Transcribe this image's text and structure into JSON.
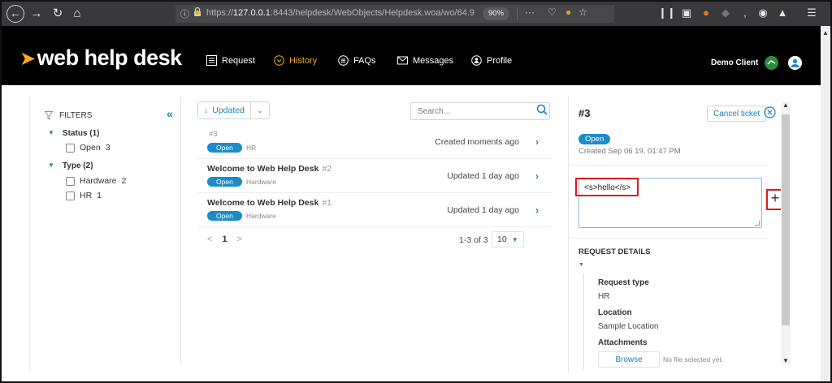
{
  "browser": {
    "url_host": "127.0.0.1",
    "url_prefix": "https://",
    "url_rest": ":8443/helpdesk/WebObjects/Helpdesk.woa/wo/64.9",
    "zoom": "90%",
    "more": "···"
  },
  "header": {
    "logo": "web help desk",
    "nav": [
      {
        "label": "Request"
      },
      {
        "label": "History"
      },
      {
        "label": "FAQs"
      },
      {
        "label": "Messages"
      },
      {
        "label": "Profile"
      }
    ],
    "user_name": "Demo Client"
  },
  "filters": {
    "title": "FILTERS",
    "groups": [
      {
        "label": "Status (1)",
        "items": [
          {
            "label": "Open",
            "count": "3"
          }
        ]
      },
      {
        "label": "Type (2)",
        "items": [
          {
            "label": "Hardware",
            "count": "2"
          },
          {
            "label": "HR",
            "count": "1"
          }
        ]
      }
    ]
  },
  "list": {
    "sort_label": "Updated",
    "search_placeholder": "Search...",
    "rows": [
      {
        "title": "",
        "num": "#3",
        "badge": "Open",
        "category": "HR",
        "status": "Created moments ago"
      },
      {
        "title": "Welcome to Web Help Desk",
        "num": "#2",
        "badge": "Open",
        "category": "Hardware",
        "status": "Updated 1 day ago"
      },
      {
        "title": "Welcome to Web Help Desk",
        "num": "#1",
        "badge": "Open",
        "category": "Hardware",
        "status": "Updated 1 day ago"
      }
    ],
    "pager": {
      "prev": "<",
      "current": "1",
      "next": ">"
    },
    "count": "1-3 of 3",
    "per_page": "10"
  },
  "detail": {
    "title": "#3",
    "cancel_label": "Cancel ticket",
    "badge": "Open",
    "created": "Created Sep 06 19, 01:47 PM",
    "note_text": "<s>hello</s>",
    "request_details": "REQUEST DETAILS",
    "request_type_label": "Request type",
    "request_type_value": "HR",
    "location_label": "Location",
    "location_value": "Sample Location",
    "attachments_label": "Attachments",
    "browse_label": "Browse",
    "no_file": "No file selected yet."
  },
  "colors": {
    "accent": "#1c8cc8",
    "active_nav": "#f2a91d",
    "highlight": "#e01a1a"
  }
}
